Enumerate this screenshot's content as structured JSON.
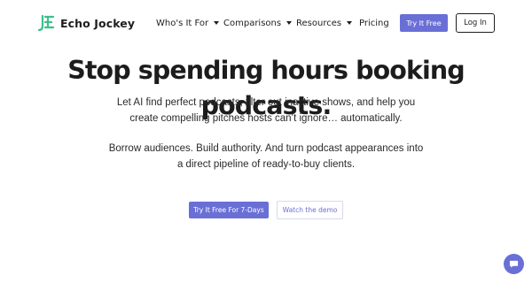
{
  "brand": {
    "name": "Echo Jockey",
    "logo_icon": "echo-jockey-logo-icon",
    "accent_color": "#6a6fd6"
  },
  "nav": {
    "items": [
      {
        "label": "Who's It For",
        "has_dropdown": true
      },
      {
        "label": "Comparisons",
        "has_dropdown": true
      },
      {
        "label": "Resources",
        "has_dropdown": true
      },
      {
        "label": "Pricing",
        "has_dropdown": false
      }
    ],
    "try_label": "Try It Free",
    "login_label": "Log In"
  },
  "hero": {
    "title": "Stop spending hours booking podcasts.",
    "paragraph1": "Let AI find perfect podcasts, filter out inactive shows, and help you create compelling pitches hosts can’t ignore… automatically.",
    "paragraph2": "Borrow audiences. Build authority. And turn podcast appearances into a direct pipeline of ready-to-buy clients.",
    "cta_primary": "Try It Free For 7-Days",
    "cta_secondary": "Watch the demo"
  },
  "chat": {
    "icon": "chat-bubble-icon"
  }
}
